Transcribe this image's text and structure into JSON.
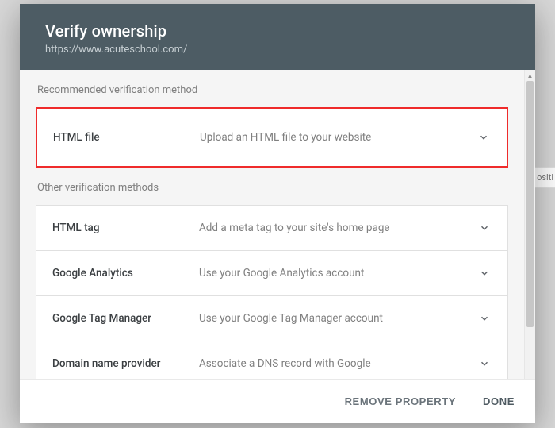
{
  "bg": {
    "col_hint": "ositi"
  },
  "header": {
    "title": "Verify ownership",
    "subtitle": "https://www.acuteschool.com/"
  },
  "sections": {
    "recommended_label": "Recommended verification method",
    "other_label": "Other verification methods"
  },
  "methods": {
    "recommended": {
      "name": "HTML file",
      "desc": "Upload an HTML file to your website"
    },
    "other": [
      {
        "name": "HTML tag",
        "desc": "Add a meta tag to your site's home page"
      },
      {
        "name": "Google Analytics",
        "desc": "Use your Google Analytics account"
      },
      {
        "name": "Google Tag Manager",
        "desc": "Use your Google Tag Manager account"
      },
      {
        "name": "Domain name provider",
        "desc": "Associate a DNS record with Google"
      }
    ]
  },
  "actions": {
    "remove": "REMOVE PROPERTY",
    "done": "DONE"
  }
}
